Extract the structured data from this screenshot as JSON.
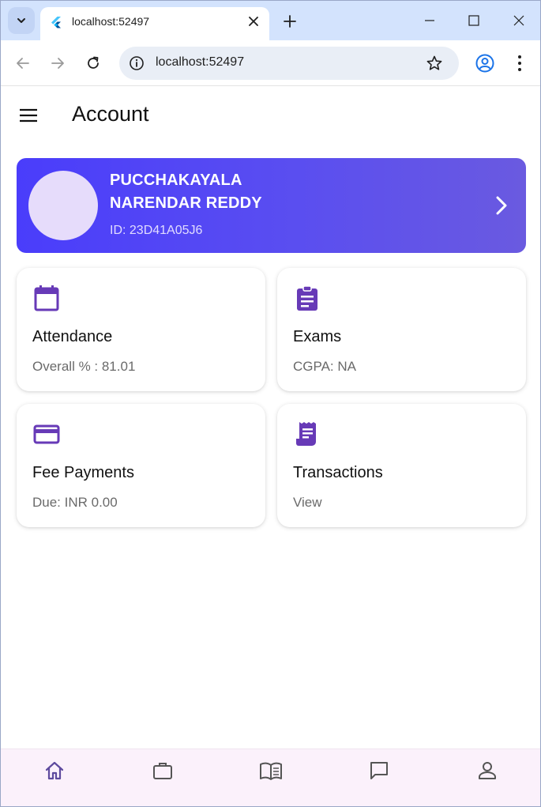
{
  "browser": {
    "tab_title": "localhost:52497",
    "url": "localhost:52497"
  },
  "app": {
    "title": "Account",
    "profile": {
      "name_line1": "PUCCHAKAYALA",
      "name_line2": "NARENDAR REDDY",
      "id": "ID: 23D41A05J6"
    },
    "tiles": [
      {
        "icon": "calendar-icon",
        "title": "Attendance",
        "subtitle": "Overall % : 81.01"
      },
      {
        "icon": "clipboard-icon",
        "title": "Exams",
        "subtitle": "CGPA: NA"
      },
      {
        "icon": "credit-card-icon",
        "title": "Fee Payments",
        "subtitle": "Due: INR 0.00"
      },
      {
        "icon": "receipt-icon",
        "title": "Transactions",
        "subtitle": "View"
      }
    ],
    "bottom_nav": [
      "home-icon",
      "briefcase-icon",
      "book-icon",
      "chat-icon",
      "person-icon"
    ]
  },
  "colors": {
    "accent": "#673ab7",
    "card_gradient_start": "#4a3dfb",
    "card_gradient_end": "#6a5ae0",
    "nav_background": "#fbf1fb"
  }
}
